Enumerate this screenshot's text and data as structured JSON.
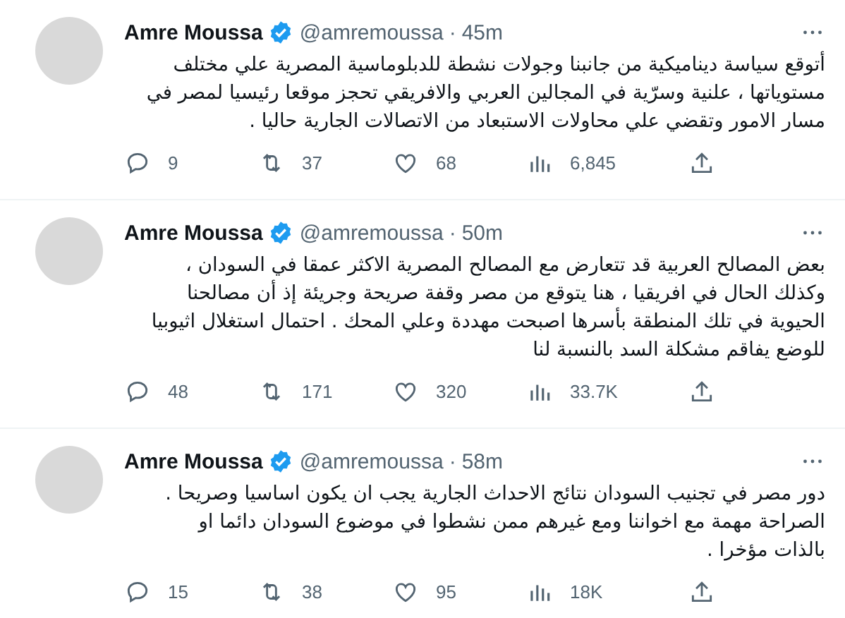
{
  "tweets": [
    {
      "name": "Amre Moussa",
      "verified": true,
      "handle": "@amremoussa",
      "sep": "·",
      "time": "45m",
      "lines": [
        "أتوقع سياسة ديناميكية من جانبنا وجولات نشطة للدبلوماسية المصرية علي مختلف",
        "مستوياتها ، علنية وسرّية في المجالين العربي والافريقي تحجز موقعا رئيسيا لمصر في",
        "مسار الامور وتقضي علي محاولات الاستبعاد من الاتصالات الجارية حاليا ."
      ],
      "replies": "9",
      "retweets": "37",
      "likes": "68",
      "views": "6,845"
    },
    {
      "name": "Amre Moussa",
      "verified": true,
      "handle": "@amremoussa",
      "sep": "·",
      "time": "50m",
      "lines": [
        "بعض المصالح العربية قد تتعارض مع المصالح المصرية الاكثر عمقا في السودان ،",
        "وكذلك الحال في افريقيا ، هنا يتوقع من مصر وقفة صريحة وجريئة إذ أن مصالحنا",
        "الحيوية في تلك المنطقة بأسرها اصبحت مهددة وعلي المحك . احتمال استغلال اثيوبيا",
        "للوضع يفاقم مشكلة السد بالنسبة لنا"
      ],
      "replies": "48",
      "retweets": "171",
      "likes": "320",
      "views": "33.7K"
    },
    {
      "name": "Amre Moussa",
      "verified": true,
      "handle": "@amremoussa",
      "sep": "·",
      "time": "58m",
      "lines": [
        "دور مصر في تجنيب السودان نتائج الاحداث الجارية يجب ان يكون اساسيا وصريحا .",
        "الصراحة مهمة مع اخواننا ومع غيرهم ممن نشطوا في موضوع السودان دائما او",
        "بالذات مؤخرا ."
      ],
      "replies": "15",
      "retweets": "38",
      "likes": "95",
      "views": "18K"
    }
  ]
}
